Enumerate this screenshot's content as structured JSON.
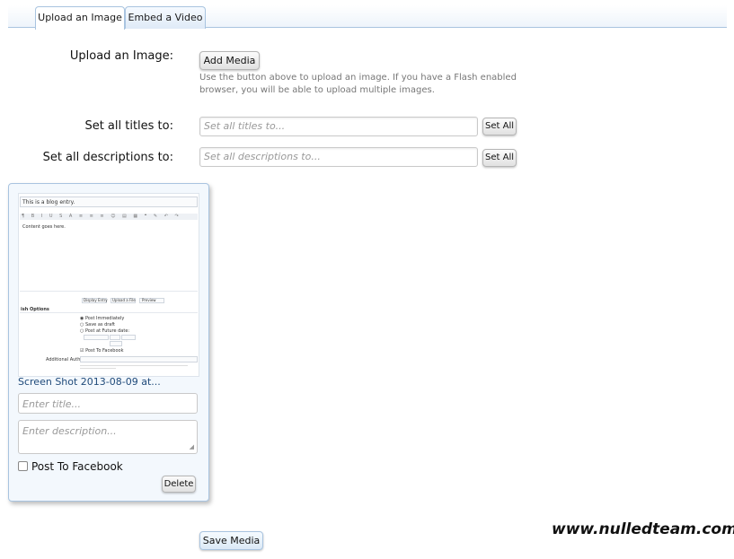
{
  "tabs": [
    {
      "label": "Upload an Image",
      "active": true
    },
    {
      "label": "Embed a Video",
      "active": false
    }
  ],
  "upload": {
    "label": "Upload an Image:",
    "button": "Add Media",
    "hint": "Use the button above to upload an image. If you have a Flash enabled browser, you will be able to upload multiple images."
  },
  "titles": {
    "label": "Set all titles to:",
    "placeholder": "Set all titles to...",
    "button": "Set All"
  },
  "descriptions": {
    "label": "Set all descriptions to:",
    "placeholder": "Set all descriptions to...",
    "button": "Set All"
  },
  "media_item": {
    "thumbnail": {
      "entry_title": "This is a blog entry.",
      "content": "Content goes here.",
      "options_heading": "ish Options",
      "options": [
        "Post Immediately",
        "Save as draft",
        "Post at Future date:"
      ],
      "post_to_facebook": "Post To Facebook",
      "additional_authors": "Additional Authors:",
      "buttons": [
        "Display Entry",
        "Upload a File",
        "Preview"
      ]
    },
    "filename": "Screen Shot 2013-08-09 at...",
    "title_placeholder": "Enter title...",
    "description_placeholder": "Enter description...",
    "facebook_label": "Post To Facebook",
    "delete_button": "Delete"
  },
  "save_button": "Save Media",
  "watermark": "www.nulledteam.com"
}
